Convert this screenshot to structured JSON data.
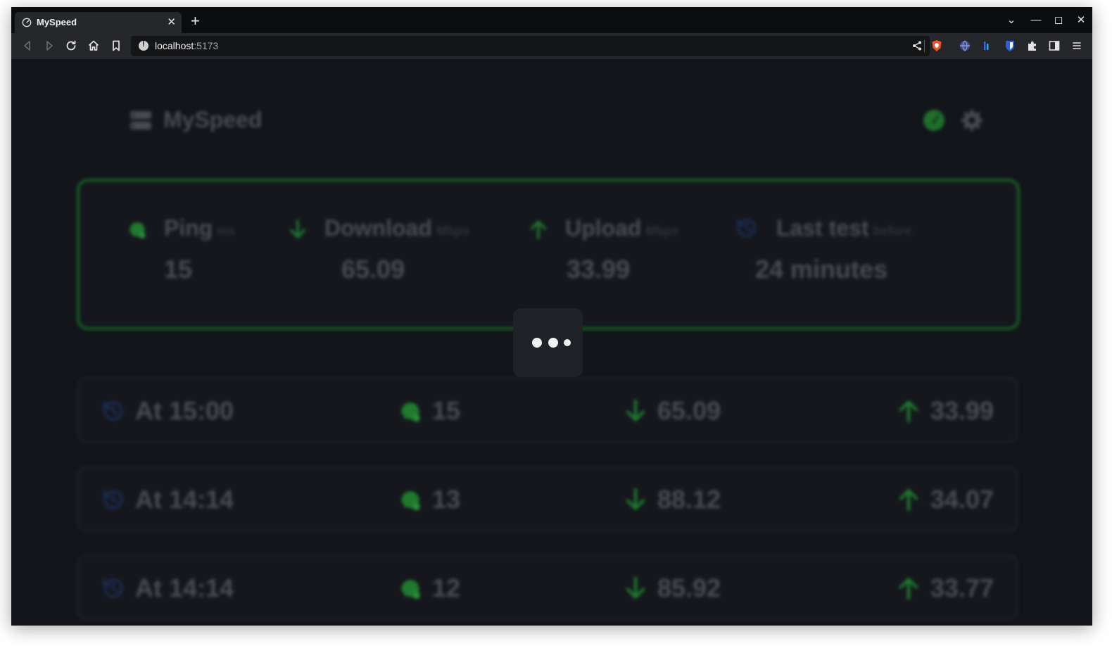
{
  "browser": {
    "tab_title": "MySpeed",
    "tab_close": "✕",
    "new_tab": "+",
    "url_host": "localhost",
    "url_port": ":5173",
    "window_controls": [
      "⌄",
      "—",
      "◻",
      "✕"
    ]
  },
  "app": {
    "brand_name": "MySpeed",
    "accent_color": "#175d25",
    "icon_green": "#1f7a2e",
    "icon_blue": "#1b2a4e"
  },
  "summary": {
    "ping": {
      "label": "Ping",
      "unit": "ms",
      "value": "15",
      "icon": "ping-icon"
    },
    "download": {
      "label": "Download",
      "unit": "Mbps",
      "value": "65.09",
      "icon": "arrow-down-icon"
    },
    "upload": {
      "label": "Upload",
      "unit": "Mbps",
      "value": "33.99",
      "icon": "arrow-up-icon"
    },
    "last_test": {
      "label": "Last test",
      "unit": "before",
      "value": "24 minutes",
      "icon": "history-icon"
    }
  },
  "tests": [
    {
      "time": "At 15:00",
      "ping": "15",
      "download": "65.09",
      "upload": "33.99"
    },
    {
      "time": "At 14:14",
      "ping": "13",
      "download": "88.12",
      "upload": "34.07"
    },
    {
      "time": "At 14:14",
      "ping": "12",
      "download": "85.92",
      "upload": "33.77"
    }
  ]
}
